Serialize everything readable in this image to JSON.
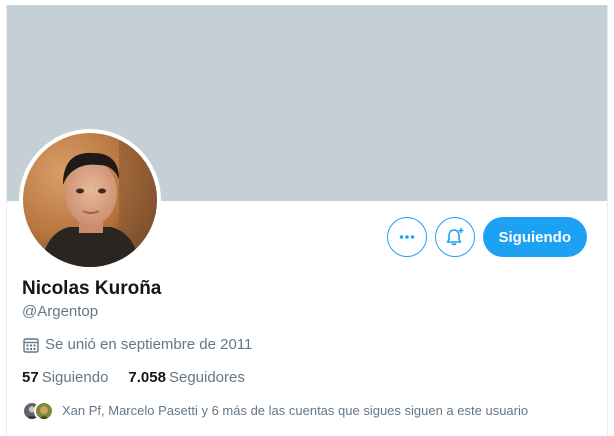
{
  "profile": {
    "display_name": "Nicolas Kuroña",
    "handle": "@Argentop",
    "joined_text": "Se unió en septiembre de 2011",
    "following_count": "57",
    "following_label": "Siguiendo",
    "followers_count": "7.058",
    "followers_label": "Seguidores",
    "followed_by_text": "Xan Pf, Marcelo Pasetti y 6 más de las cuentas que sigues siguen a este usuario"
  },
  "actions": {
    "more_icon": "more-horizontal-icon",
    "notify_icon": "bell-plus-icon",
    "follow_label": "Siguiendo"
  },
  "colors": {
    "banner": "#c4cfd6",
    "accent": "#1da1f2",
    "secondary_text": "#657786",
    "primary_text": "#14171a"
  }
}
